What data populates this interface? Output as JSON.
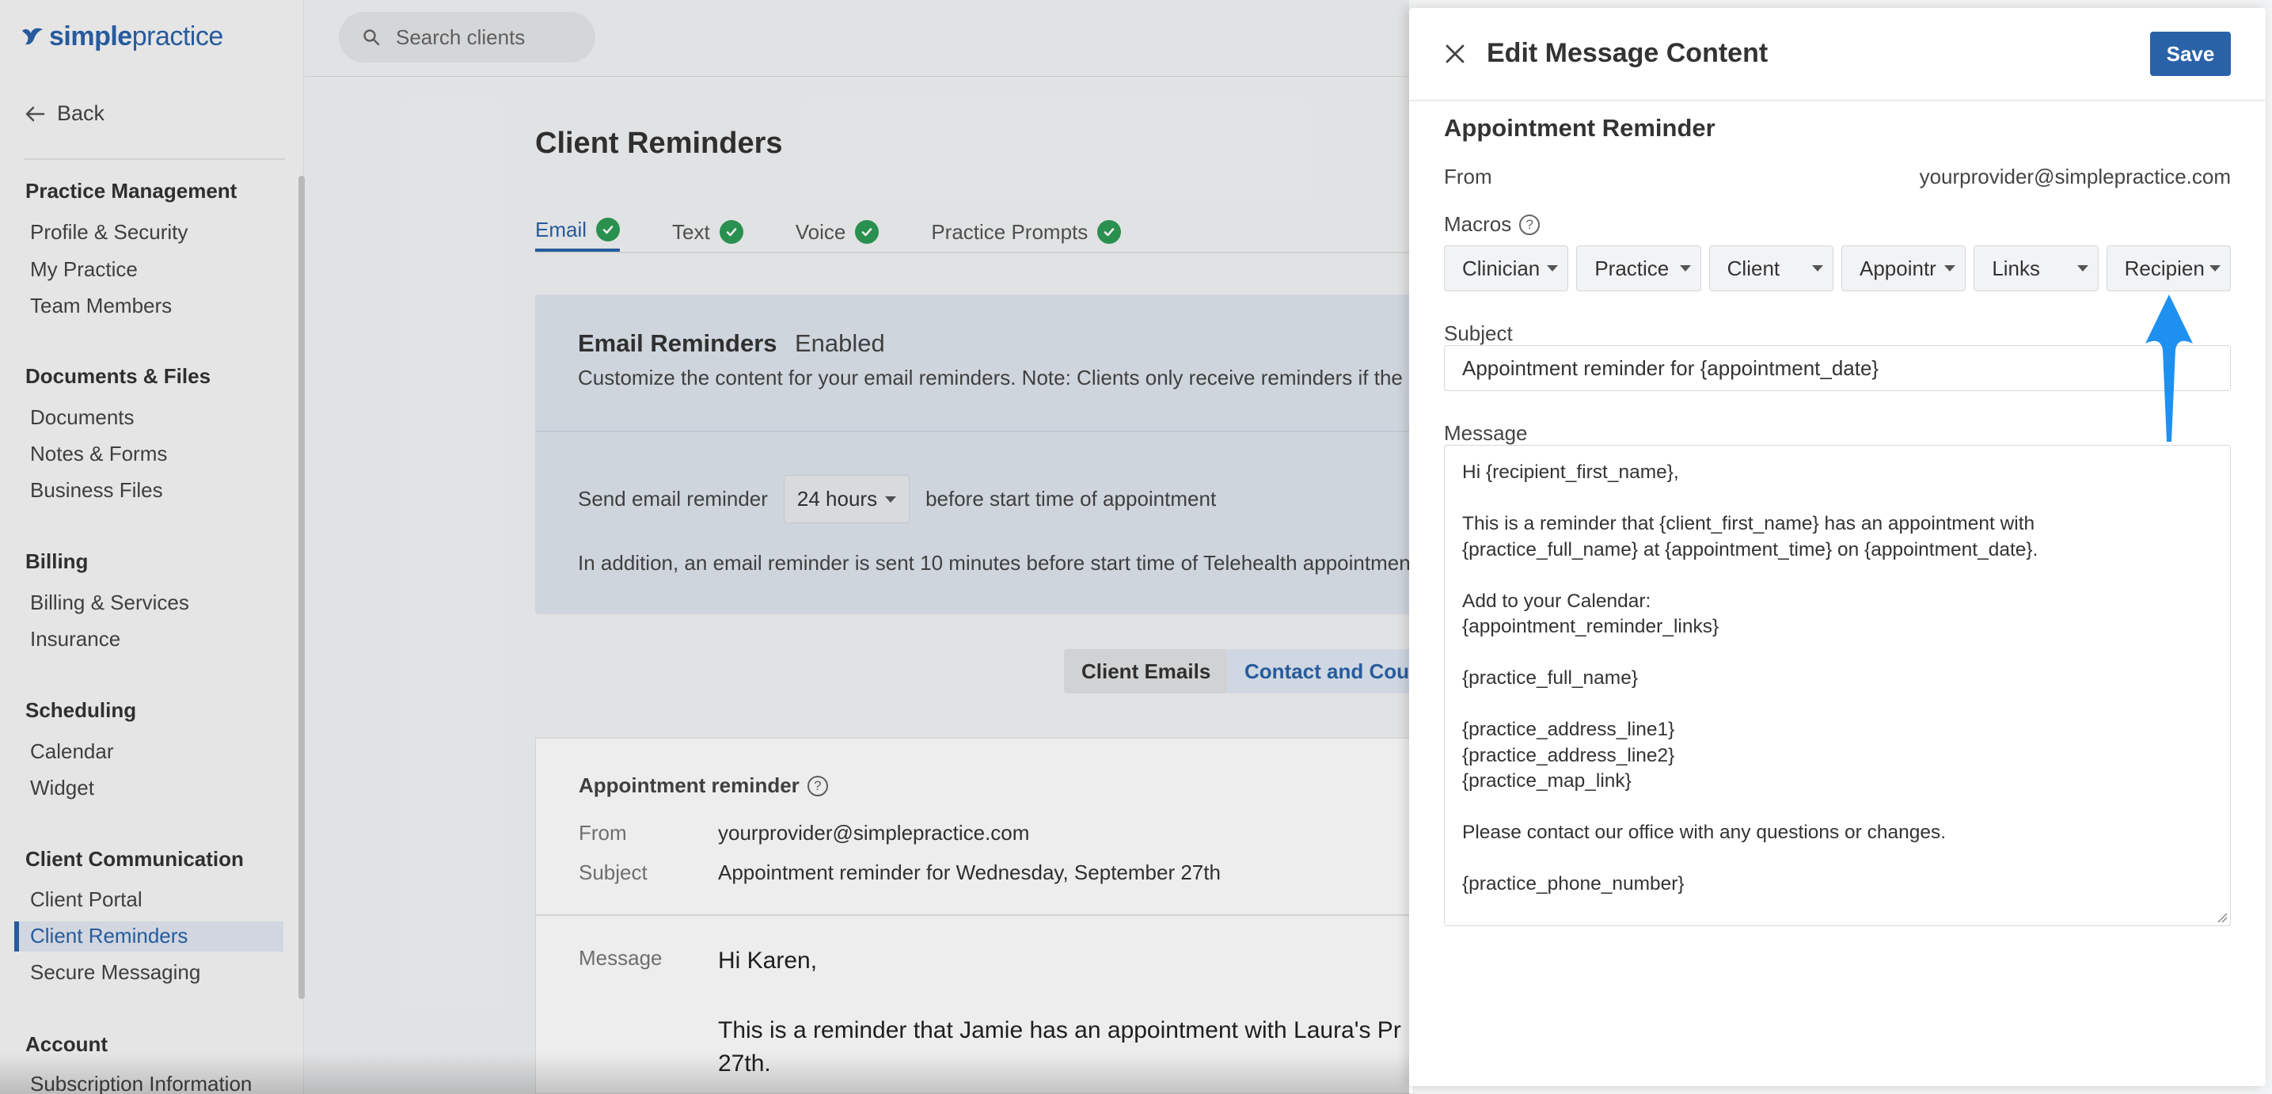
{
  "app": {
    "logo_text_bold": "simple",
    "logo_text_rest": "practice"
  },
  "sidebar": {
    "back_label": "Back",
    "sections": [
      {
        "title": "Practice Management",
        "items": [
          "Profile & Security",
          "My Practice",
          "Team Members"
        ]
      },
      {
        "title": "Documents & Files",
        "items": [
          "Documents",
          "Notes & Forms",
          "Business Files"
        ]
      },
      {
        "title": "Billing",
        "items": [
          "Billing & Services",
          "Insurance"
        ]
      },
      {
        "title": "Scheduling",
        "items": [
          "Calendar",
          "Widget"
        ]
      },
      {
        "title": "Client Communication",
        "items": [
          "Client Portal",
          "Client Reminders",
          "Secure Messaging"
        ]
      },
      {
        "title": "Account",
        "items": [
          "Subscription Information"
        ]
      }
    ],
    "active_item": "Client Reminders"
  },
  "search": {
    "placeholder": "Search clients"
  },
  "main": {
    "title": "Client Reminders",
    "tabs": [
      {
        "label": "Email",
        "active": true
      },
      {
        "label": "Text",
        "active": false
      },
      {
        "label": "Voice",
        "active": false
      },
      {
        "label": "Practice Prompts",
        "active": false
      }
    ],
    "info": {
      "title": "Email Reminders",
      "status": "Enabled",
      "description": "Customize the content for your email reminders. Note: Clients only receive reminders if the",
      "send_label": "Send email reminder",
      "send_value": "24 hours",
      "send_suffix": "before start time of appointment",
      "extra_note": "In addition, an email reminder is sent 10 minutes before start time of Telehealth appointmen"
    },
    "buttons": {
      "client_emails": "Client Emails",
      "contact": "Contact and Coup"
    },
    "preview": {
      "title": "Appointment reminder",
      "from_label": "From",
      "from_value": "yourprovider@simplepractice.com",
      "subject_label": "Subject",
      "subject_value": "Appointment reminder for Wednesday, September 27th",
      "message_label": "Message",
      "body_line1": "Hi Karen,",
      "body_line2": "This is a reminder that Jamie has an appointment with Laura's Pr",
      "body_line3": "27th."
    }
  },
  "drawer": {
    "title": "Edit Message Content",
    "save_label": "Save",
    "heading": "Appointment Reminder",
    "from_label": "From",
    "from_value": "yourprovider@simplepractice.com",
    "macros_label": "Macros",
    "macros": [
      "Clinician",
      "Practice",
      "Client",
      "Appointr",
      "Links",
      "Recipien"
    ],
    "subject_label": "Subject",
    "subject_value": "Appointment reminder for {appointment_date}",
    "message_label": "Message",
    "message_value": "Hi {recipient_first_name},\n\nThis is a reminder that {client_first_name} has an appointment with\n{practice_full_name} at {appointment_time} on {appointment_date}.\n\nAdd to your Calendar:\n{appointment_reminder_links}\n\n{practice_full_name}\n\n{practice_address_line1}\n{practice_address_line2}\n{practice_map_link}\n\nPlease contact our office with any questions or changes.\n\n{practice_phone_number}"
  },
  "colors": {
    "brand": "#2a62a8",
    "success": "#2e9b55",
    "arrow": "#1e90f0"
  }
}
